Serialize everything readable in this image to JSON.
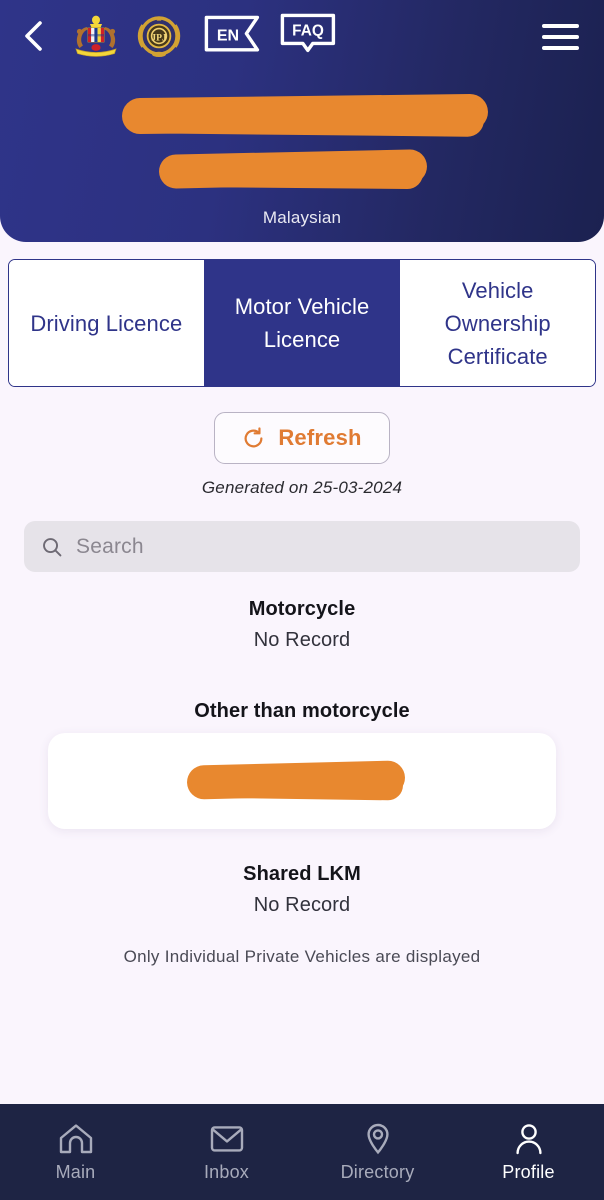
{
  "header": {
    "back_icon": "chevron-left-icon",
    "emblems": [
      {
        "name": "jata-negara-emblem",
        "alt": "Malaysian coat of arms"
      },
      {
        "name": "jpj-emblem",
        "alt": "JPJ road transport department emblem"
      }
    ],
    "language_badge": "EN",
    "faq_badge": "FAQ",
    "menu_icon": "hamburger-menu-icon",
    "redacted_name": "",
    "redacted_id": "",
    "nationality": "Malaysian",
    "gradient_from": "#2F3489",
    "gradient_to": "#1B2150"
  },
  "tabs": [
    {
      "label": "Driving Licence",
      "active": false
    },
    {
      "label": "Motor Vehicle Licence",
      "active": true
    },
    {
      "label": "Vehicle Ownership Certificate",
      "active": false
    }
  ],
  "refresh": {
    "label": "Refresh",
    "icon": "refresh-icon",
    "accent_color": "#E07B33",
    "generated_text": "Generated on 25-03-2024"
  },
  "search": {
    "placeholder": "Search",
    "value": "",
    "icon": "search-icon"
  },
  "sections": [
    {
      "title": "Motorcycle",
      "value": "No Record"
    },
    {
      "title": "Other than motorcycle",
      "value": ""
    },
    {
      "title": "Shared LKM",
      "value": "No Record"
    }
  ],
  "disclaimer": "Only Individual Private Vehicles are displayed",
  "bottom_nav": [
    {
      "label": "Main",
      "icon": "home-icon",
      "active": false
    },
    {
      "label": "Inbox",
      "icon": "envelope-icon",
      "active": false
    },
    {
      "label": "Directory",
      "icon": "map-pin-icon",
      "active": false
    },
    {
      "label": "Profile",
      "icon": "person-icon",
      "active": true
    }
  ],
  "colors": {
    "brand_indigo": "#2F3489",
    "nav_navy": "#1E2444",
    "orange_accent": "#E8882F",
    "page_bg": "#FAF5FD"
  }
}
